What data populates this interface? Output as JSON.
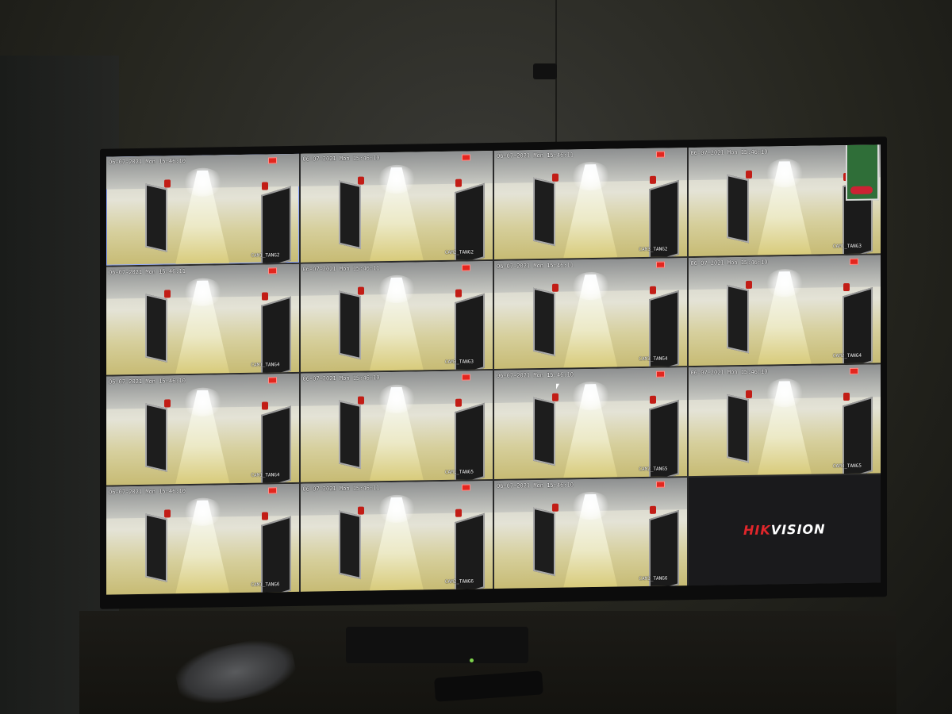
{
  "nvr_display": {
    "logo": {
      "part1": "HIK",
      "part2": "VISION"
    },
    "tiles": [
      {
        "time": "06-07-2021 Mon 15:46:10",
        "name": "CAM1_TANG2",
        "selected": true
      },
      {
        "time": "06-07-2021 Mon 15:46:10",
        "name": "CAM2_TANG2"
      },
      {
        "time": "06-07-2021 Mon 15:46:11",
        "name": "CAM3_TANG2"
      },
      {
        "time": "06-07-2021 Mon 15:46:10",
        "name": "CAM1_TANG3"
      },
      {
        "time": "06-07-2021 Mon 15:46:11",
        "name": "CAM1_TANG4"
      },
      {
        "time": "06-07-2021 Mon 15:46:11",
        "name": "CAM3_TANG3"
      },
      {
        "time": "06-07-2021 Mon 15:46:11",
        "name": "CAM3_TANG4"
      },
      {
        "time": "06-07-2021 Mon 15:46:10",
        "name": "CAM2_TANG4"
      },
      {
        "time": "06-07-2021 Mon 15:46:10",
        "name": "CAM1_TANG4"
      },
      {
        "time": "06-07-2021 Mon 15:46:10",
        "name": "CAM1_TANG5"
      },
      {
        "time": "06-07-2021 Mon 15:46:10",
        "name": "CAM2_TANG5"
      },
      {
        "time": "06-07-2021 Mon 15:46:10",
        "name": "CAM3_TANG5"
      },
      {
        "time": "06-07-2021 Mon 15:46:10",
        "name": "CAM1_TANG6"
      },
      {
        "time": "06-07-2021 Mon 15:46:11",
        "name": "CAM2_TANG6"
      },
      {
        "time": "06-07-2021 Mon 15:46:10",
        "name": "CAM3_TANG6"
      }
    ],
    "colors": {
      "brand_red": "#e0262b",
      "alarm_red": "#c21d16",
      "floor": "#d6cf9c"
    }
  }
}
